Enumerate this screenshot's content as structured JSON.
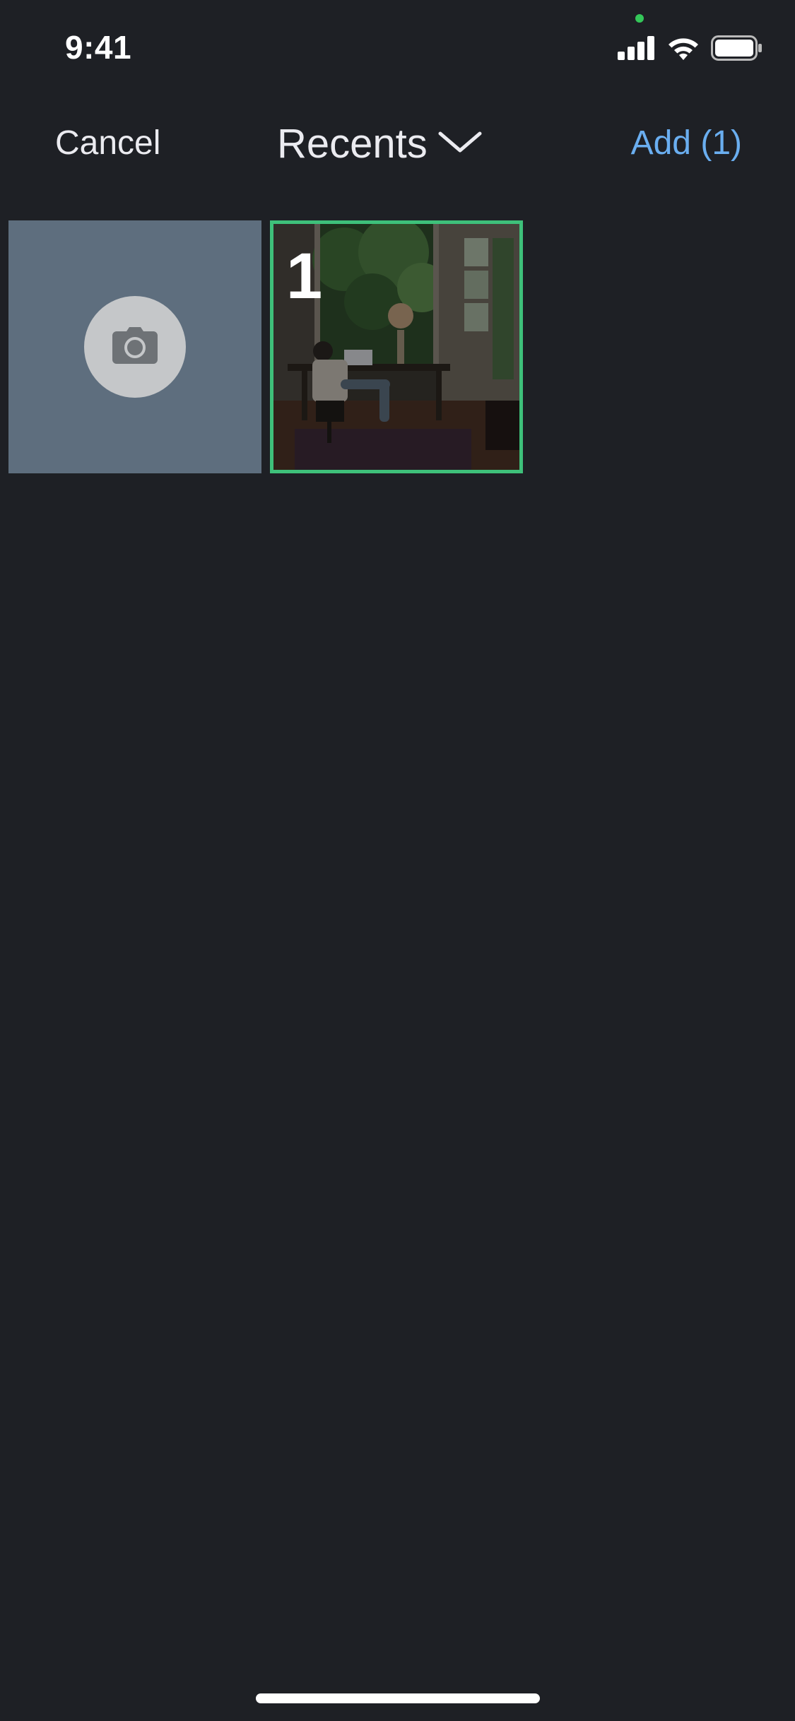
{
  "status_bar": {
    "time": "9:41"
  },
  "nav": {
    "cancel_label": "Cancel",
    "title": "Recents",
    "add_label": "Add (1)"
  },
  "grid": {
    "items": [
      {
        "type": "camera",
        "icon": "camera-icon"
      },
      {
        "type": "photo",
        "selected": true,
        "selection_number": "1"
      }
    ]
  },
  "colors": {
    "background": "#1e2025",
    "accent": "#6aaef0",
    "selection_border": "#3ec07a",
    "camera_tile": "#5e6e7e"
  }
}
